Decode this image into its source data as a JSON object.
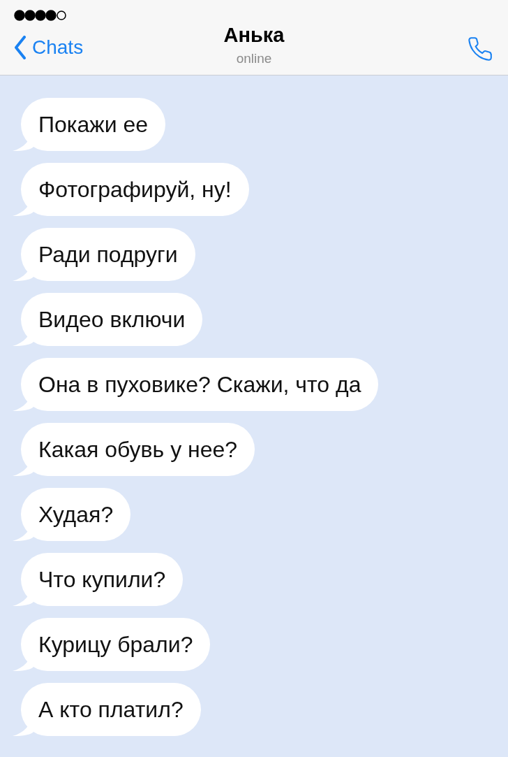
{
  "header": {
    "back_label": "Chats",
    "title": "Анька",
    "status": "online"
  },
  "messages": [
    {
      "text": "Покажи ее"
    },
    {
      "text": "Фотографируй, ну!"
    },
    {
      "text": "Ради подруги"
    },
    {
      "text": "Видео включи"
    },
    {
      "text": "Она в пуховике? Скажи, что да"
    },
    {
      "text": "Какая обувь у нее?"
    },
    {
      "text": "Худая?"
    },
    {
      "text": "Что купили?"
    },
    {
      "text": "Курицу брали?"
    },
    {
      "text": "А кто платил?"
    }
  ]
}
